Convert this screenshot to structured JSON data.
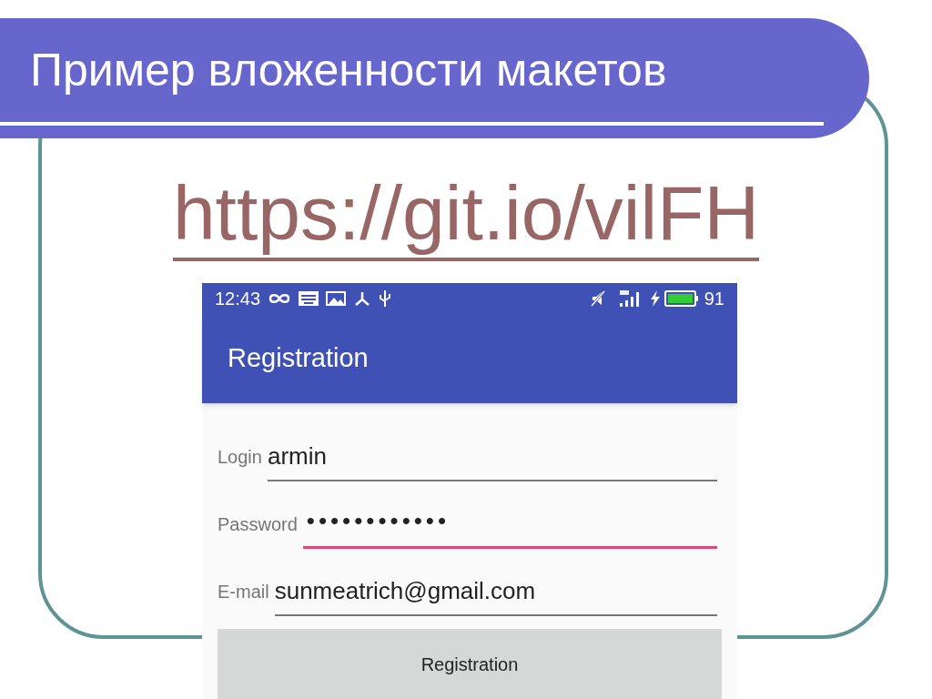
{
  "slide": {
    "title": "Пример вложенности макетов",
    "link": "https://git.io/vilFH"
  },
  "phone": {
    "status_bar": {
      "time": "12:43",
      "battery": "91"
    },
    "app_bar": {
      "title": "Registration"
    },
    "fields": [
      {
        "label": "Login",
        "value": "armin",
        "focused": false
      },
      {
        "label": "Password",
        "value": "••••••••••••",
        "focused": true
      },
      {
        "label": "E-mail",
        "value": "sunmeatrich@gmail.com",
        "focused": false
      }
    ],
    "button": "Registration"
  }
}
